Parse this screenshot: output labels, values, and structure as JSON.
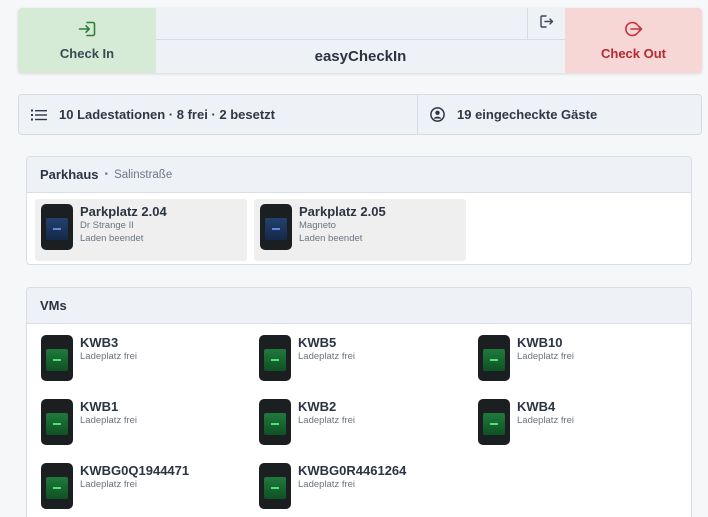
{
  "header": {
    "checkin_label": "Check In",
    "checkout_label": "Check Out",
    "app_title": "easyCheckIn",
    "checkin_color": "#d6ebd6",
    "checkout_color": "#f7d6d6"
  },
  "summary": {
    "stations_text": "10 Ladestationen · 8 frei · 2 besetzt",
    "guests_text": "19 eingecheckte Gäste"
  },
  "sections": [
    {
      "title": "Parkhaus",
      "subtitle": "Salinstraße",
      "stations": [
        {
          "name": "Parkplatz 2.04",
          "guest": "Dr Strange II",
          "status": "Laden beendet"
        },
        {
          "name": "Parkplatz 2.05",
          "guest": "Magneto",
          "status": "Laden beendet"
        }
      ]
    },
    {
      "title": "VMs",
      "stations": [
        {
          "name": "KWB3",
          "status": "Ladeplatz frei"
        },
        {
          "name": "KWB5",
          "status": "Ladeplatz frei"
        },
        {
          "name": "KWB10",
          "status": "Ladeplatz frei"
        },
        {
          "name": "KWB1",
          "status": "Ladeplatz frei"
        },
        {
          "name": "KWB2",
          "status": "Ladeplatz frei"
        },
        {
          "name": "KWB4",
          "status": "Ladeplatz frei"
        },
        {
          "name": "KWBG0Q1944471",
          "status": "Ladeplatz frei"
        },
        {
          "name": "KWBG0R4461264",
          "status": "Ladeplatz frei"
        }
      ]
    }
  ],
  "icons": {
    "checkin": "login-arrow-icon",
    "checkout": "logout-arrow-icon",
    "logout": "sign-out-icon",
    "stations": "list-icon",
    "guests": "user-circle-icon",
    "charger_taken": "charger-blue-icon",
    "charger_free": "charger-green-icon"
  }
}
